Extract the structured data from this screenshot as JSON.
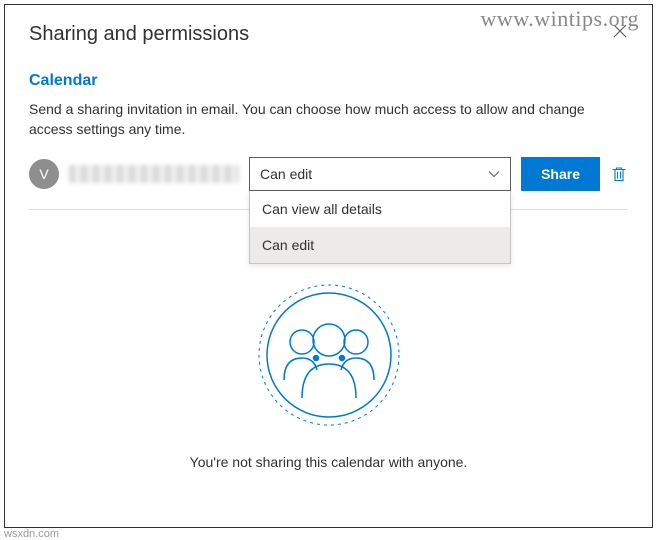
{
  "header": {
    "title": "Sharing and permissions"
  },
  "section": {
    "title": "Calendar",
    "description": "Send a sharing invitation in email. You can choose how much access to allow and change access settings any time."
  },
  "shareRow": {
    "avatarInitial": "V",
    "permission": {
      "selected": "Can edit",
      "options": [
        "Can view all details",
        "Can edit"
      ]
    },
    "shareButton": "Share"
  },
  "emptyState": {
    "caption": "You're not sharing this calendar with anyone."
  },
  "watermarks": {
    "top": "www.wintips.org",
    "bottom": "wsxdn.com"
  }
}
